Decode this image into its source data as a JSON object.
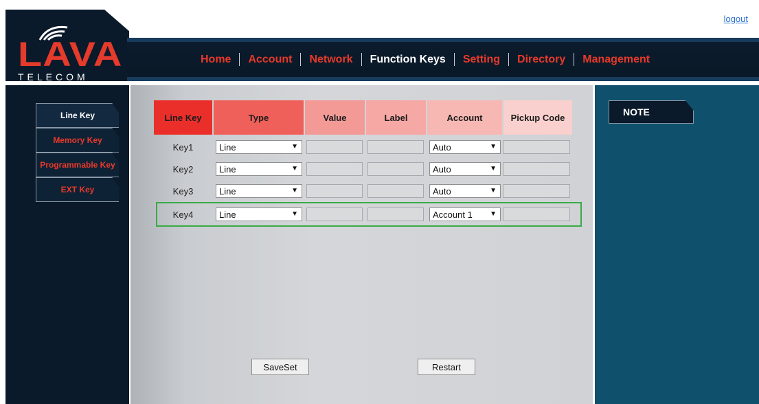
{
  "logo": {
    "brand": "LAVA",
    "sub": "TELECOM"
  },
  "logout_label": "logout",
  "nav": {
    "items": [
      {
        "label": "Home",
        "active": false
      },
      {
        "label": "Account",
        "active": false
      },
      {
        "label": "Network",
        "active": false
      },
      {
        "label": "Function Keys",
        "active": true
      },
      {
        "label": "Setting",
        "active": false
      },
      {
        "label": "Directory",
        "active": false
      },
      {
        "label": "Management",
        "active": false
      }
    ]
  },
  "sidebar": {
    "items": [
      {
        "label": "Line Key",
        "active": true
      },
      {
        "label": "Memory Key",
        "active": false
      },
      {
        "label": "Programmable Key",
        "active": false
      },
      {
        "label": "EXT Key",
        "active": false
      }
    ]
  },
  "note_label": "NOTE",
  "table": {
    "headers": [
      "Line Key",
      "Type",
      "Value",
      "Label",
      "Account",
      "Pickup Code"
    ],
    "rows": [
      {
        "key": "Key1",
        "type": "Line",
        "value": "",
        "label": "",
        "account": "Auto",
        "pickup": ""
      },
      {
        "key": "Key2",
        "type": "Line",
        "value": "",
        "label": "",
        "account": "Auto",
        "pickup": ""
      },
      {
        "key": "Key3",
        "type": "Line",
        "value": "",
        "label": "",
        "account": "Auto",
        "pickup": ""
      },
      {
        "key": "Key4",
        "type": "Line",
        "value": "",
        "label": "",
        "account": "Account 1",
        "pickup": ""
      }
    ],
    "highlighted_row": "Key4"
  },
  "buttons": {
    "save": "SaveSet",
    "restart": "Restart"
  },
  "colors": {
    "brand_red": "#e8392a",
    "dark_navy": "#0b1a2a",
    "teal_panel": "#0f506d",
    "highlight_green": "#3aaa47"
  }
}
